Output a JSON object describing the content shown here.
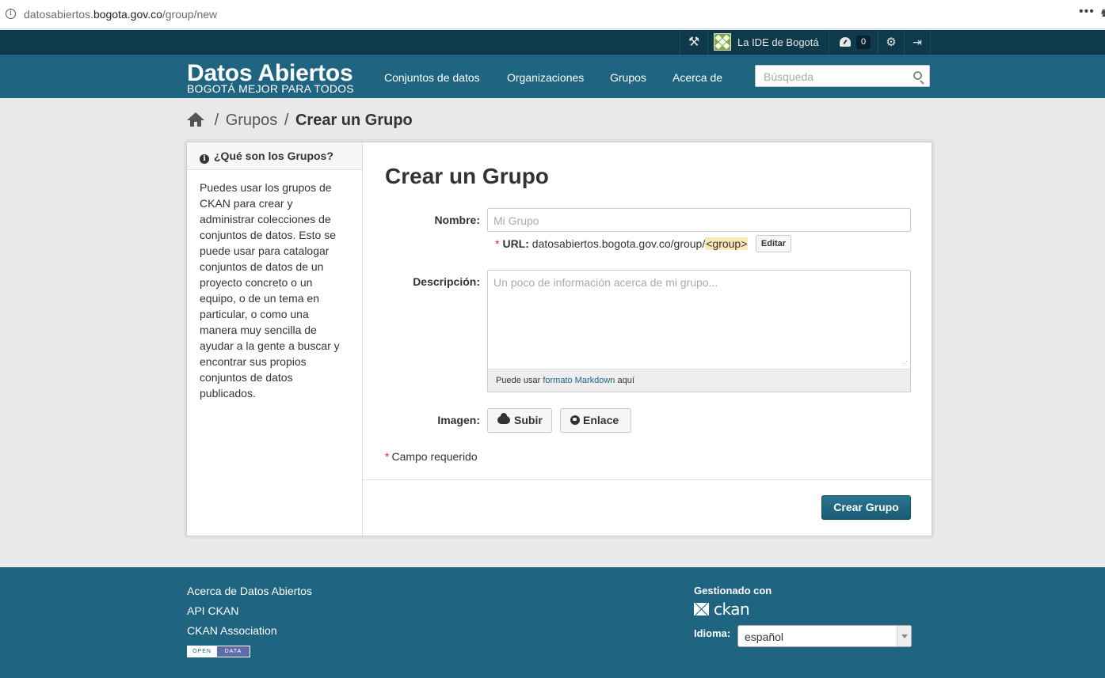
{
  "browser": {
    "url_prefix": "datosabiertos.",
    "url_domain": "bogota.gov.co",
    "url_path": "/group/new",
    "more_label": "•••",
    "extension_glyph": "♞"
  },
  "account": {
    "user_name": "La IDE de Bogotá",
    "dashboard_count": "0"
  },
  "header": {
    "site_title": "Datos Abiertos",
    "site_tagline": "BOGOTÁ MEJOR PARA TODOS",
    "nav": [
      "Conjuntos de datos",
      "Organizaciones",
      "Grupos",
      "Acerca de"
    ],
    "search_placeholder": "Búsqueda"
  },
  "breadcrumb": {
    "sep": "/",
    "parent": "Grupos",
    "current": "Crear un Grupo"
  },
  "sidebar": {
    "title": "¿Qué son los Grupos?",
    "info_glyph": "i",
    "text": "Puedes usar los grupos de CKAN para crear y administrar colecciones de conjuntos de datos. Esto se puede usar para catalogar conjuntos de datos de un proyecto concreto o un equipo, o de un tema en particular, o como una manera muy sencilla de ayudar a la gente a buscar y encontrar sus propios conjuntos de datos publicados."
  },
  "form": {
    "heading": "Crear un Grupo",
    "name_label": "Nombre:",
    "name_placeholder": "Mi Grupo",
    "required_mark": "*",
    "url_label": "URL:",
    "url_base": "datosabiertos.bogota.gov.co/group/",
    "url_slug": "<group>",
    "edit_button": "Editar",
    "description_label": "Descripción:",
    "description_placeholder": "Un poco de información acerca de mi grupo...",
    "markdown_prefix": "Puede usar ",
    "markdown_link": "formato Markdown",
    "markdown_suffix": " aquí",
    "image_label": "Imagen:",
    "upload_button": "Subir",
    "link_button": "Enlace",
    "required_note": "Campo requerido",
    "submit_button": "Crear Grupo"
  },
  "footer": {
    "links": [
      "Acerca de Datos Abiertos",
      "API CKAN",
      "CKAN Association"
    ],
    "open_data_left": "OPEN",
    "open_data_right": "DATA",
    "managed_by": "Gestionado con",
    "ckan_logo": "ckan",
    "language_label": "Idioma:",
    "language_value": "español"
  },
  "colors": {
    "brand": "#1f6582",
    "masthead_dark": "#0f3a4c",
    "required": "#c6303e"
  }
}
